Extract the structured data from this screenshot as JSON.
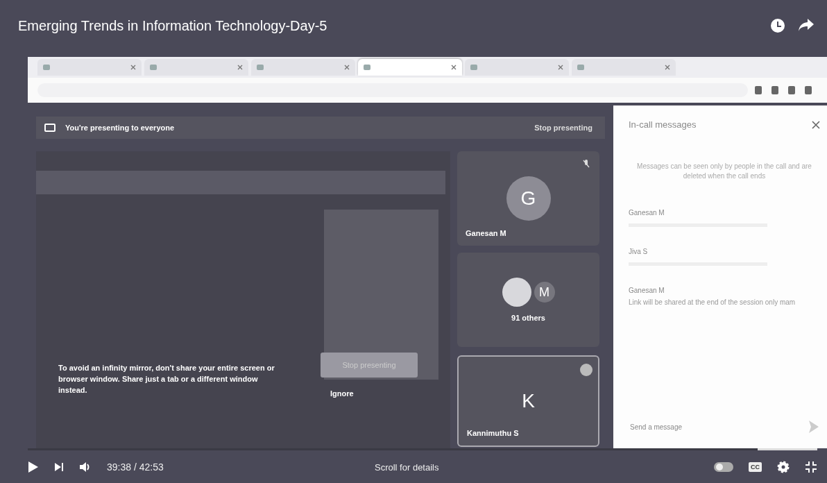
{
  "video": {
    "title": "Emerging Trends in Information Technology-Day-5",
    "time": "39:38 / 42:53",
    "level": 0.924,
    "scroll_hint": "Scroll for details",
    "captions": "CC"
  },
  "browser": {
    "tabs": [
      {
        "selected": false
      },
      {
        "selected": false
      },
      {
        "selected": false
      },
      {
        "selected": true
      },
      {
        "selected": false
      },
      {
        "selected": false
      }
    ]
  },
  "meet": {
    "banner": "You're presenting to everyone",
    "stop_button": "Stop presenting",
    "warning": "To avoid an infinity mirror, don't share your entire screen or browser window. Share just a tab or a different window instead.",
    "warning_button": "Stop presenting",
    "ignore_button": "Ignore",
    "tiles": [
      {
        "kind": "avatar",
        "initial": "G",
        "name": "Ganesan M"
      },
      {
        "kind": "group",
        "initial": "M",
        "name": "91 others"
      },
      {
        "kind": "framed",
        "initial": "K",
        "name": "Kannimuthu S"
      }
    ]
  },
  "chat": {
    "title": "In-call messages",
    "notice": "Messages can be seen only by people in the call and are deleted when the call ends",
    "messages": [
      {
        "sender": "Ganesan M"
      },
      {
        "sender": "Jiva S"
      },
      {
        "sender": "Ganesan M",
        "text": "Link will be shared at the end of the session only mam"
      }
    ],
    "placeholder": "Send a message"
  }
}
